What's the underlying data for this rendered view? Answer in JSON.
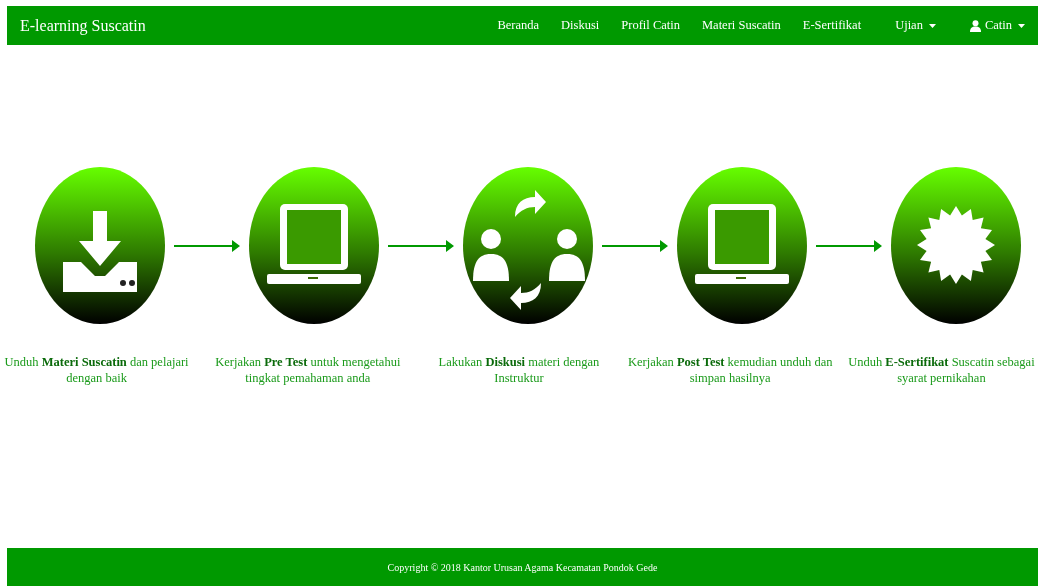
{
  "navbar": {
    "brand": "E-learning Suscatin",
    "items": [
      {
        "label": "Beranda",
        "kind": "link"
      },
      {
        "label": "Diskusi",
        "kind": "link"
      },
      {
        "label": "Profil Catin",
        "kind": "link"
      },
      {
        "label": "Materi Suscatin",
        "kind": "link"
      },
      {
        "label": "E-Sertifikat",
        "kind": "link"
      },
      {
        "label": "Ujian",
        "kind": "dropdown"
      },
      {
        "label": "Catin",
        "kind": "user-dropdown"
      }
    ]
  },
  "steps": [
    {
      "kind": "download",
      "caption": "Unduh **Materi Suscatin** dan pelajari dengan baik"
    },
    {
      "kind": "laptop",
      "caption": "Kerjakan **Pre Test** untuk mengetahui tingkat pemahaman anda"
    },
    {
      "kind": "discussion",
      "caption": "Lakukan **Diskusi** materi dengan Instruktur"
    },
    {
      "kind": "laptop",
      "caption": "Kerjakan **Post Test** kemudian unduh dan simpan hasilnya"
    },
    {
      "kind": "badge",
      "caption": "Unduh **E-Sertifikat** Suscatin sebagai syarat pernikahan"
    }
  ],
  "footer": {
    "text": "Copyright © 2018 Kantor Urusan Agama Kecamatan Pondok Gede"
  }
}
